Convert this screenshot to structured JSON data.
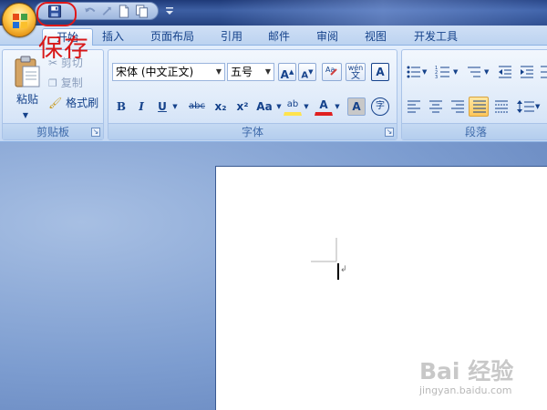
{
  "annotation": {
    "text": "保存",
    "color": "#d81818"
  },
  "tabs": [
    {
      "label": "开始",
      "active": true
    },
    {
      "label": "插入"
    },
    {
      "label": "页面布局"
    },
    {
      "label": "引用"
    },
    {
      "label": "邮件"
    },
    {
      "label": "审阅"
    },
    {
      "label": "视图"
    },
    {
      "label": "开发工具"
    }
  ],
  "clipboard": {
    "paste_label": "粘贴",
    "cut_label": "剪切",
    "copy_label": "复制",
    "format_painter_label": "格式刷",
    "group_label": "剪贴板"
  },
  "font": {
    "font_name": "宋体 (中文正文)",
    "font_size": "五号",
    "grow": "A",
    "shrink": "A",
    "pinyin": "wén",
    "border_char": "A",
    "bold": "B",
    "italic": "I",
    "underline": "U",
    "strike": "abc",
    "subscript": "x₂",
    "superscript": "x²",
    "change_case": "Aa",
    "highlight": "ab",
    "font_color": "A",
    "char_shade": "A",
    "enclose": "字",
    "group_label": "字体"
  },
  "paragraph": {
    "group_label": "段落"
  },
  "watermark": {
    "logo": "Bai 经验",
    "url": "jingyan.baidu.com"
  },
  "colors": {
    "accent": "#15428b",
    "annotation": "#d81818",
    "highlight": "#ffe34d",
    "font_color_bar": "#e02020"
  }
}
